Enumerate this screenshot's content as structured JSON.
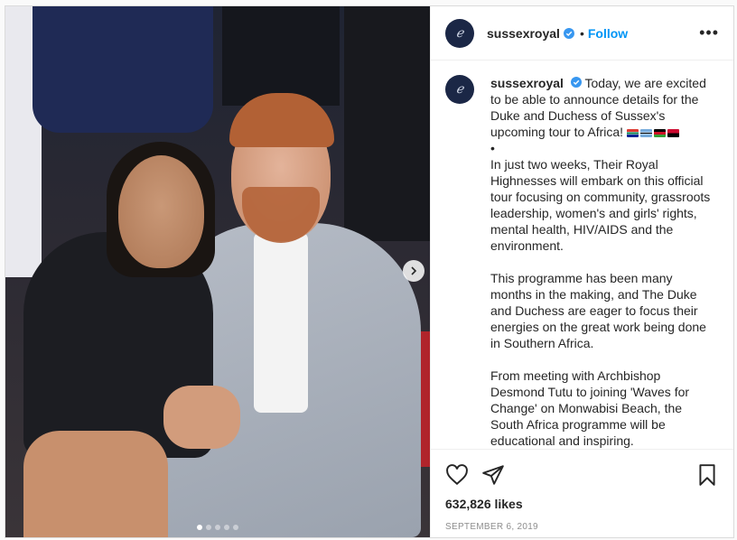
{
  "post": {
    "username": "sussexroyal",
    "follow_label": "Follow",
    "separator": "•",
    "more_label": "•••",
    "avatar_glyph": "ℯ",
    "caption": {
      "intro": "Today, we are excited to be able to announce details for the Duke and Duchess of Sussex's upcoming tour to Africa!",
      "bullet": "•",
      "para1": "In just two weeks, Their Royal Highnesses will embark on this official tour focusing on community, grassroots leadership, women's and girls' rights, mental health, HIV/AIDS and the environment.",
      "para2": "This programme has been many months in the making, and The Duke and Duchess are eager to focus their energies on the great work being done in Southern Africa.",
      "para3": "From meeting with Archbishop Desmond Tutu to joining 'Waves for Change' on Monwabisi Beach, the South Africa programme will be educational and inspiring."
    },
    "likes": "632,826 likes",
    "date": "SEPTEMBER 6, 2019",
    "carousel": {
      "total": 5,
      "active_index": 0
    },
    "colors": {
      "accent": "#0095f6",
      "verified": "#3897f0"
    },
    "icons": [
      "like-icon",
      "share-icon",
      "bookmark-icon",
      "verified-icon",
      "next-icon",
      "more-icon"
    ]
  }
}
